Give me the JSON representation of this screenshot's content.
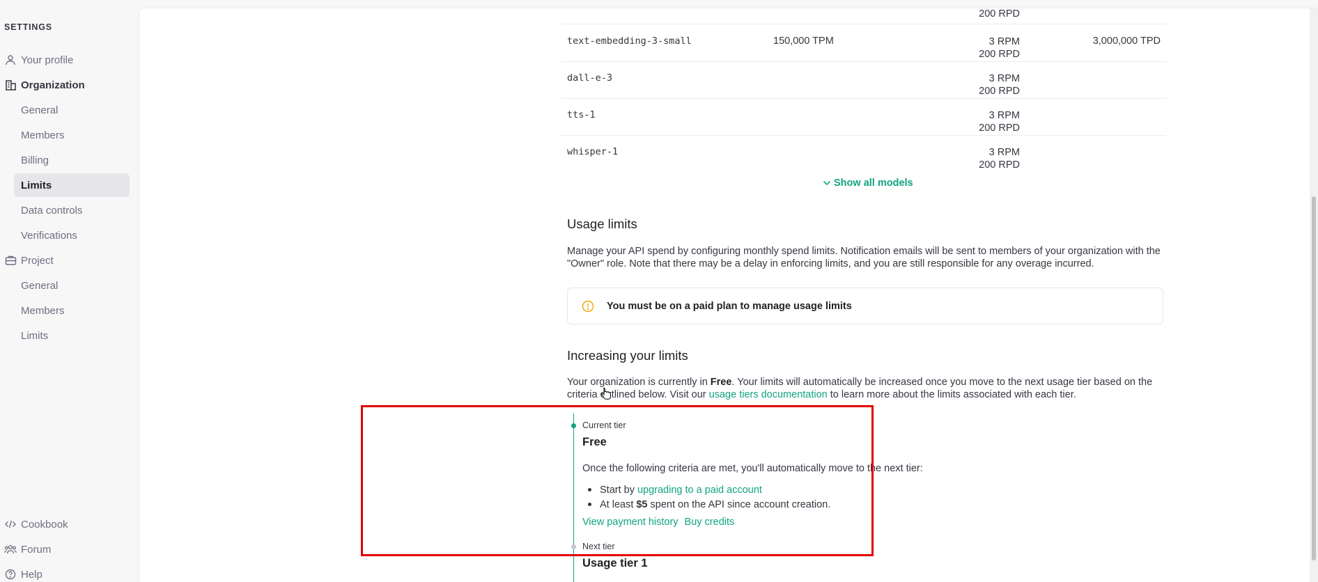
{
  "sidebar": {
    "heading": "SETTINGS",
    "top_items": [
      {
        "label": "Your profile"
      },
      {
        "label": "Organization"
      }
    ],
    "org_items": [
      {
        "label": "General"
      },
      {
        "label": "Members"
      },
      {
        "label": "Billing"
      },
      {
        "label": "Limits",
        "active": true
      },
      {
        "label": "Data controls"
      },
      {
        "label": "Verifications"
      }
    ],
    "project_label": "Project",
    "project_items": [
      {
        "label": "General"
      },
      {
        "label": "Members"
      },
      {
        "label": "Limits"
      }
    ],
    "footer_items": [
      {
        "label": "Cookbook"
      },
      {
        "label": "Forum"
      },
      {
        "label": "Help"
      }
    ]
  },
  "models_table": {
    "rows": [
      {
        "model": "",
        "tpm": "",
        "rpm": "",
        "rpd": "200 RPD",
        "tpd": ""
      },
      {
        "model": "text-embedding-3-small",
        "tpm": "150,000 TPM",
        "rpm": "3 RPM",
        "rpd": "200 RPD",
        "tpd": "3,000,000 TPD"
      },
      {
        "model": "dall-e-3",
        "tpm": "",
        "rpm": "3 RPM",
        "rpd": "200 RPD",
        "tpd": ""
      },
      {
        "model": "tts-1",
        "tpm": "",
        "rpm": "3 RPM",
        "rpd": "200 RPD",
        "tpd": ""
      },
      {
        "model": "whisper-1",
        "tpm": "",
        "rpm": "3 RPM",
        "rpd": "200 RPD",
        "tpd": ""
      }
    ],
    "show_all_label": "Show all models"
  },
  "usage_limits": {
    "title": "Usage limits",
    "description": "Manage your API spend by configuring monthly spend limits. Notification emails will be sent to members of your organization with the \"Owner\" role. Note that there may be a delay in enforcing limits, and you are still responsible for any overage incurred.",
    "alert": "You must be on a paid plan to manage usage limits"
  },
  "increasing": {
    "title": "Increasing your limits",
    "text_1": "Your organization is currently in ",
    "tier_bold": "Free",
    "text_2": ". Your limits will automatically be increased once you move to the next usage tier based on the criteria outlined below. Visit our ",
    "link": "usage tiers documentation",
    "text_3": " to learn more about the limits associated with each tier."
  },
  "current_tier": {
    "label": "Current tier",
    "name": "Free",
    "criteria_intro": "Once the following criteria are met, you'll automatically move to the next tier:",
    "bullet_1_prefix": "Start by",
    "bullet_1_link": "upgrading to a paid account",
    "bullet_2_prefix": "At least",
    "bullet_2_bold": "$5",
    "bullet_2_suffix": "spent on the API since account creation.",
    "link_payment_history": "View payment history",
    "link_buy_credits": "Buy credits"
  },
  "next_tier": {
    "label": "Next tier",
    "name": "Usage tier 1"
  },
  "colors": {
    "accent": "#10a37f",
    "highlight": "#e00000",
    "warning": "#f4a100"
  }
}
